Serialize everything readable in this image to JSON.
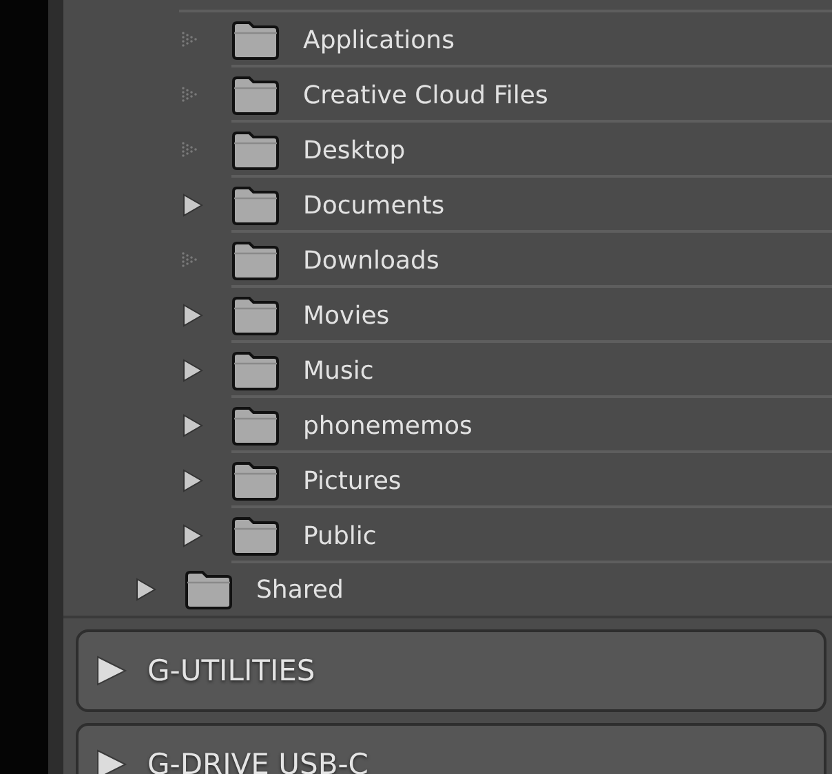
{
  "folder_children": [
    {
      "name": "Applications",
      "has_subfolders": false
    },
    {
      "name": "Creative Cloud Files",
      "has_subfolders": false
    },
    {
      "name": "Desktop",
      "has_subfolders": false
    },
    {
      "name": "Documents",
      "has_subfolders": true
    },
    {
      "name": "Downloads",
      "has_subfolders": false
    },
    {
      "name": "Movies",
      "has_subfolders": true
    },
    {
      "name": "Music",
      "has_subfolders": true
    },
    {
      "name": "phonememos",
      "has_subfolders": true
    },
    {
      "name": "Pictures",
      "has_subfolders": true
    },
    {
      "name": "Public",
      "has_subfolders": true
    }
  ],
  "sibling_folder": {
    "name": "Shared",
    "has_subfolders": true
  },
  "volumes": [
    {
      "name": "G-UTILITIES",
      "expanded": false
    },
    {
      "name": "G-DRIVE USB-C",
      "expanded": false
    }
  ]
}
